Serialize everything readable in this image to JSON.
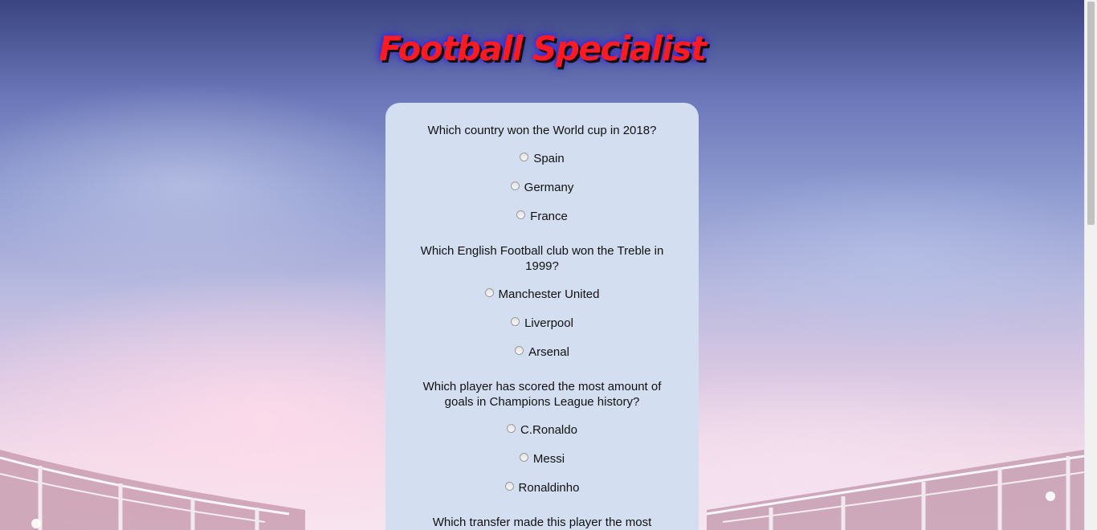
{
  "title": "Football Specialist",
  "questions": [
    {
      "text": "Which country won the World cup in 2018?",
      "options": [
        "Spain",
        "Germany",
        "France"
      ]
    },
    {
      "text": "Which English Football club won the Treble in 1999?",
      "options": [
        "Manchester United",
        "Liverpool",
        "Arsenal"
      ]
    },
    {
      "text": "Which player has scored the most amount of goals in Champions League history?",
      "options": [
        "C.Ronaldo",
        "Messi",
        "Ronaldinho"
      ]
    },
    {
      "text": "Which transfer made this player the most expensive"
    }
  ],
  "colors": {
    "title": "#ff1a24",
    "title_glow": "#2a1bd6",
    "card_background": "#d3dff1"
  }
}
